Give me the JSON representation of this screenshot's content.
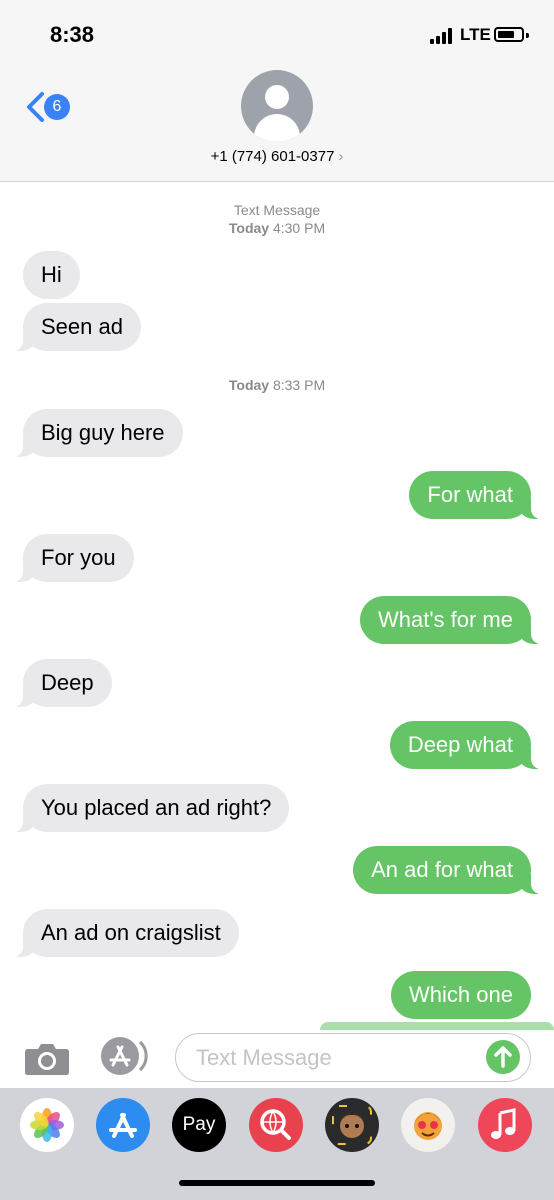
{
  "status_bar": {
    "time": "8:38",
    "network": "LTE"
  },
  "header": {
    "back_badge": "6",
    "contact_number": "+1 (774) 601-0377",
    "chevron": "›"
  },
  "timestamps": [
    {
      "label": "Text Message",
      "day": "Today",
      "time": "4:30 PM"
    },
    {
      "label": "",
      "day": "Today",
      "time": "8:33 PM"
    }
  ],
  "messages": [
    {
      "text": "Hi",
      "direction": "in"
    },
    {
      "text": "Seen ad",
      "direction": "in"
    },
    {
      "text": "Big guy here",
      "direction": "in"
    },
    {
      "text": "For what",
      "direction": "out"
    },
    {
      "text": "For you",
      "direction": "in"
    },
    {
      "text": "What's for me",
      "direction": "out"
    },
    {
      "text": "Deep",
      "direction": "in"
    },
    {
      "text": "Deep what",
      "direction": "out"
    },
    {
      "text": "You placed an ad right?",
      "direction": "in"
    },
    {
      "text": "An ad for what",
      "direction": "out"
    },
    {
      "text": "An ad on craigslist",
      "direction": "in"
    },
    {
      "text": "Which one",
      "direction": "out"
    }
  ],
  "composer": {
    "placeholder": "Text Message",
    "value": ""
  },
  "dock": {
    "apps": [
      "photos-icon",
      "app-store-icon",
      "apple-pay-icon",
      "web-search-icon",
      "memoji-icon",
      "memoji-stickers-icon",
      "music-icon"
    ],
    "pay_label": "Pay",
    "pay_logo": ""
  },
  "colors": {
    "sent": "#65c466",
    "received": "#e9e9eb",
    "accent": "#3a82f7"
  }
}
